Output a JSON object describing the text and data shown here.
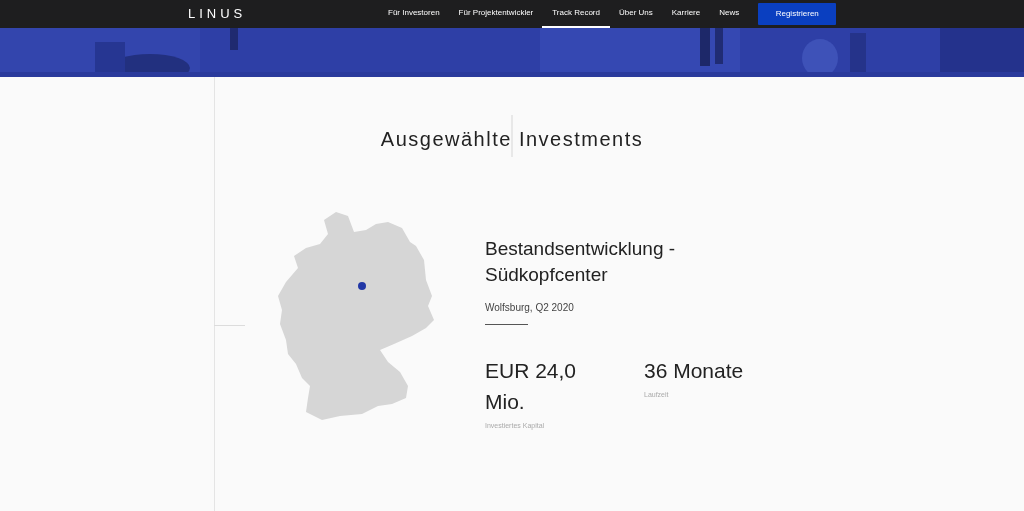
{
  "header": {
    "logo": "LINUS",
    "nav": [
      {
        "label": "Für Investoren",
        "selected": false
      },
      {
        "label": "Für Projektentwickler",
        "selected": false
      },
      {
        "label": "Track Record",
        "selected": true
      },
      {
        "label": "Über Uns",
        "selected": false
      },
      {
        "label": "Karriere",
        "selected": false
      },
      {
        "label": "News",
        "selected": false
      }
    ],
    "cta": "Registrieren"
  },
  "section": {
    "title": "Ausgewählte Investments"
  },
  "investment": {
    "title": "Bestandsentwicklung - Südkopfcenter",
    "subtitle": "Wolfsburg, Q2 2020",
    "stats": [
      {
        "value": "EUR 24,0 Mio.",
        "label": "Investiertes Kapital"
      },
      {
        "value": "36 Monate",
        "label": "Laufzeit"
      }
    ]
  }
}
